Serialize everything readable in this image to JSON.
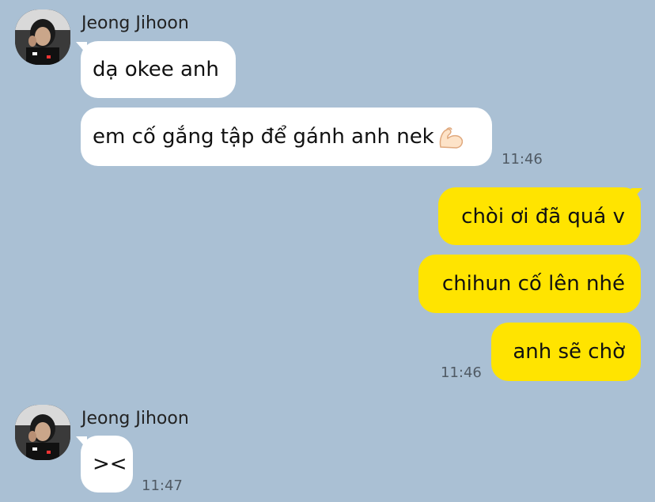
{
  "colors": {
    "background": "#aac0d4",
    "incoming_bubble": "#ffffff",
    "outgoing_bubble": "#ffe400"
  },
  "group1": {
    "sender": "Jeong Jihoon",
    "avatar": "profile-photo",
    "messages": [
      "dạ okee anh",
      "em cố gắng tập để gánh anh nek"
    ],
    "emoji": "flexed-biceps-icon",
    "time": "11:46"
  },
  "outgoing": {
    "messages": [
      "chòi ơi đã quá v",
      "chihun cố lên nhé",
      "anh sẽ chờ"
    ],
    "time": "11:46"
  },
  "group2": {
    "sender": "Jeong Jihoon",
    "avatar": "profile-photo",
    "messages": [
      "><"
    ],
    "time": "11:47"
  }
}
